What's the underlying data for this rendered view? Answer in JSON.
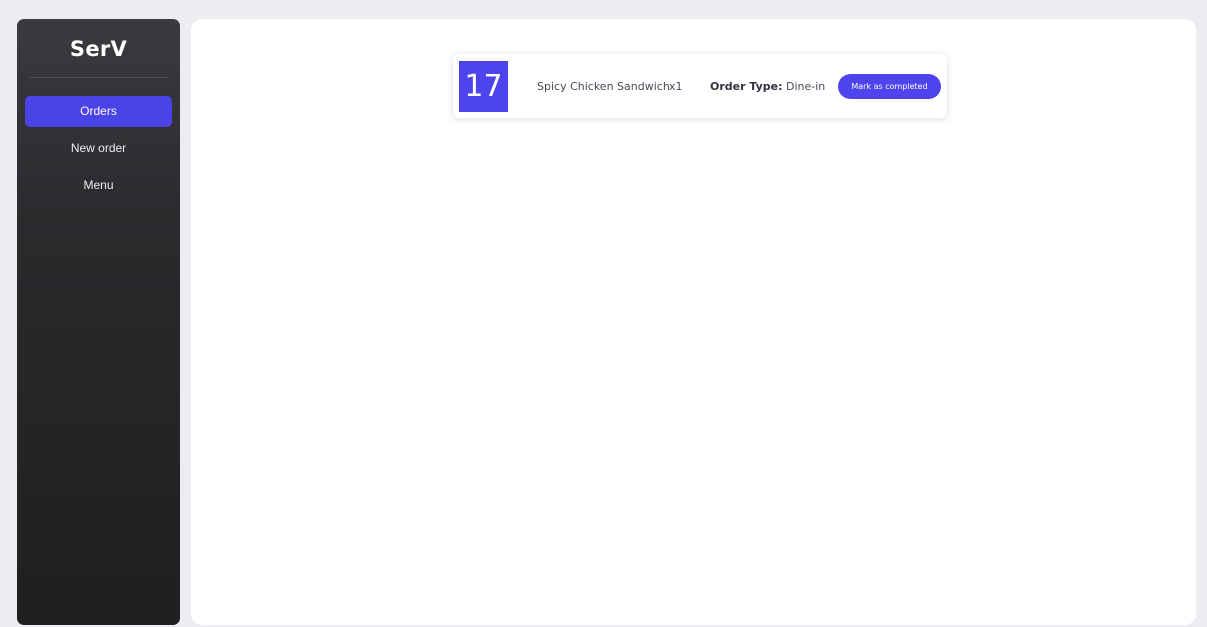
{
  "sidebar": {
    "brand": "SerV",
    "items": [
      {
        "label": "Orders",
        "active": true
      },
      {
        "label": "New order",
        "active": false
      },
      {
        "label": "Menu",
        "active": false
      }
    ]
  },
  "orders": [
    {
      "number": "17",
      "item": "Spicy Chicken Sandwich",
      "quantity": "x1",
      "type_label": "Order Type:",
      "type_value": "Dine-in",
      "action_label": "Mark as completed"
    }
  ],
  "colors": {
    "accent": "#4d44ee",
    "sidebar_top": "#3b3b3f",
    "sidebar_bottom": "#1f1f21",
    "background": "#ededf1"
  }
}
